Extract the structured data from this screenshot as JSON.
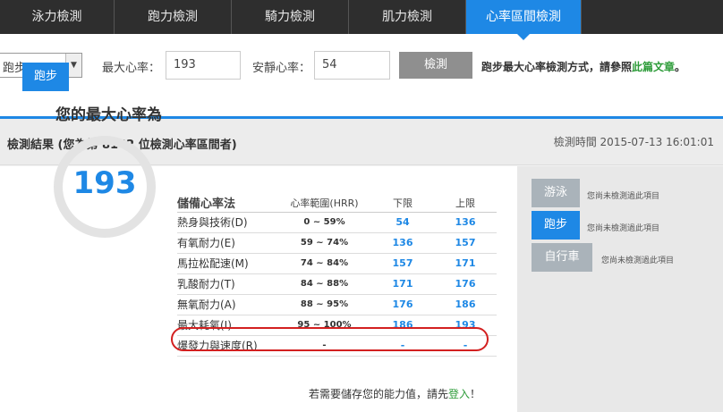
{
  "tabs": [
    "泳力檢測",
    "跑力檢測",
    "騎力檢測",
    "肌力檢測",
    "心率區間檢測"
  ],
  "form": {
    "sport_select": "跑步",
    "max_hr_label": "最大心率：",
    "max_hr_value": "193",
    "rest_hr_label": "安靜心率：",
    "rest_hr_value": "54",
    "check_button": "檢測",
    "note_prefix": "跑步最大心率檢測方式，請參照",
    "note_link": "此篇文章",
    "note_suffix": "。"
  },
  "result": {
    "title": "檢測結果 (您為第 8142 位檢測心率區間者)",
    "time": "檢測時間 2015-07-13 16:01:01",
    "sport_badge": "跑步",
    "max_label": "您的最大心率為",
    "max_value": "193",
    "table": {
      "headers": [
        "儲備心率法",
        "心率範圍(HRR)",
        "下限",
        "上限"
      ],
      "rows": [
        {
          "name": "熱身與技術(D)",
          "range": "0 ~ 59%",
          "low": "54",
          "high": "136"
        },
        {
          "name": "有氧耐力(E)",
          "range": "59 ~ 74%",
          "low": "136",
          "high": "157"
        },
        {
          "name": "馬拉松配速(M)",
          "range": "74 ~ 84%",
          "low": "157",
          "high": "171"
        },
        {
          "name": "乳酸耐力(T)",
          "range": "84 ~ 88%",
          "low": "171",
          "high": "176"
        },
        {
          "name": "無氧耐力(A)",
          "range": "88 ~ 95%",
          "low": "176",
          "high": "186"
        },
        {
          "name": "最大耗氧(I)",
          "range": "95 ~ 100%",
          "low": "186",
          "high": "193"
        },
        {
          "name": "爆發力與速度(R)",
          "range": "-",
          "low": "-",
          "high": "-"
        }
      ]
    },
    "login_prefix": "若需要儲存您的能力值，請先",
    "login_link": "登入",
    "login_suffix": "！"
  },
  "sports": [
    {
      "label": "游泳",
      "status": "您尚未檢測過此項目"
    },
    {
      "label": "跑步",
      "status": "您尚未檢測過此項目"
    },
    {
      "label": "自行車",
      "status": "您尚未檢測過此項目"
    }
  ],
  "colors": {
    "accent": "#1e88e5",
    "highlight": "#d32020",
    "link": "#2e9c3a"
  }
}
